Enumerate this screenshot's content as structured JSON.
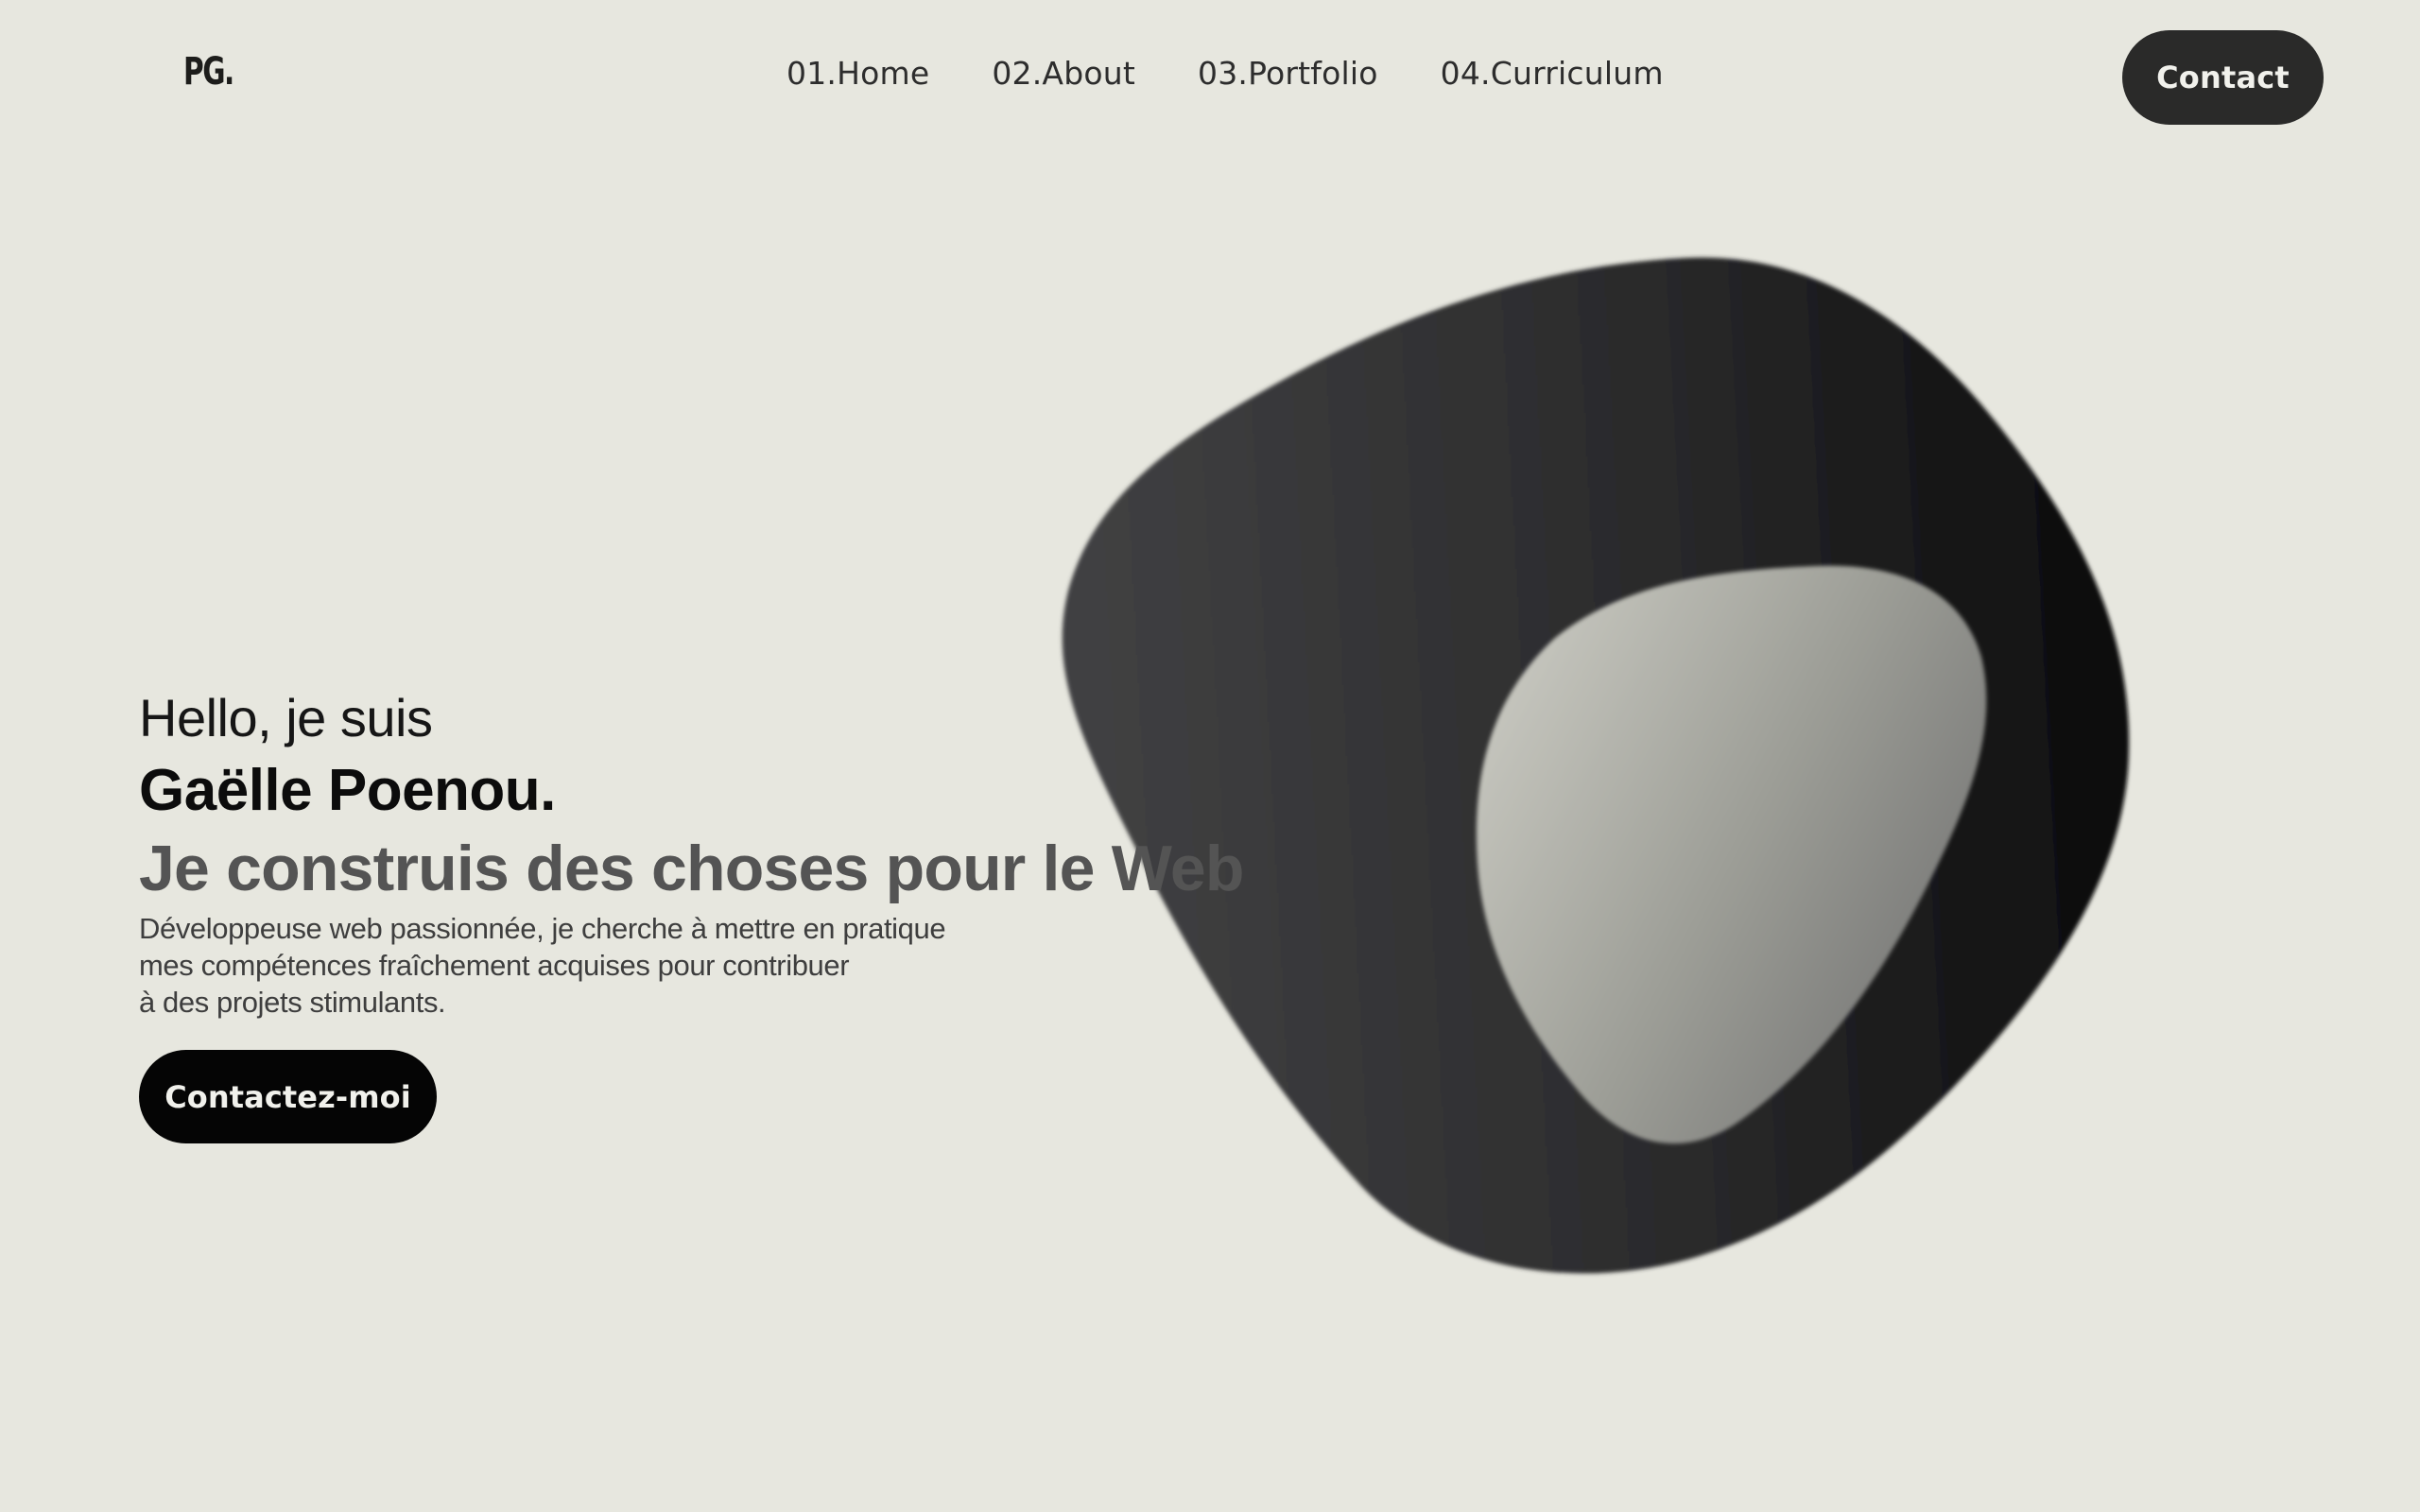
{
  "header": {
    "logo": "PG.",
    "nav": [
      {
        "label": "01.Home"
      },
      {
        "label": "02.About"
      },
      {
        "label": "03.Portfolio"
      },
      {
        "label": "04.Curriculum"
      }
    ],
    "contact_label": "Contact"
  },
  "hero": {
    "greeting": "Hello, je suis",
    "name": "Gaëlle Poenou.",
    "tagline": "Je construis des choses pour le Web",
    "bio_lines": [
      "Développeuse web passionnée, je cherche à mettre en pratique",
      "mes compétences fraîchement acquises pour contribuer",
      "à des projets stimulants."
    ],
    "cta_label": "Contactez-moi"
  },
  "colors": {
    "background": "#e7e7df",
    "dark_button": "#2a2a29",
    "cta_button": "#050505",
    "text_muted": "#545454"
  }
}
